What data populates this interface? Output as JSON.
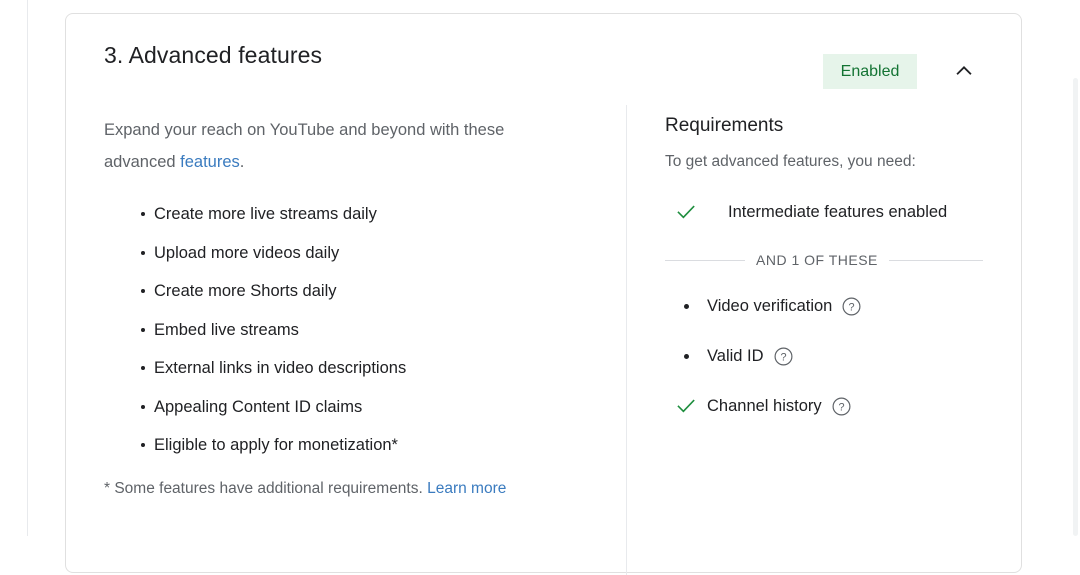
{
  "card": {
    "title": "3. Advanced features",
    "status_badge": "Enabled",
    "collapse_icon": "chevron-up-icon",
    "badge_bg_color": "#e6f4ea",
    "badge_text_color": "#137333"
  },
  "left": {
    "lede_before": "Expand your reach on YouTube and beyond with these advanced ",
    "lede_link": "features",
    "lede_after": ".",
    "features": [
      "Create more live streams daily",
      "Upload more videos daily",
      "Create more Shorts daily",
      "Embed live streams",
      "External links in video descriptions",
      "Appealing Content ID claims",
      "Eligible to apply for monetization*"
    ],
    "footnote_text": "* Some features have additional requirements. ",
    "footnote_link": "Learn more",
    "link_color": "#3a7bbf"
  },
  "right": {
    "title": "Requirements",
    "subtitle": "To get advanced features, you need:",
    "primary_requirement": {
      "label": "Intermediate features enabled",
      "marker": "check-icon",
      "status": "met"
    },
    "divider_label": "AND 1 OF THESE",
    "options": [
      {
        "label": "Video verification",
        "marker": "bullet",
        "status": "unmet",
        "help": "help-circle-icon"
      },
      {
        "label": "Valid ID",
        "marker": "bullet",
        "status": "unmet",
        "help": "help-circle-icon"
      },
      {
        "label": "Channel history",
        "marker": "check-icon",
        "status": "met",
        "help": "help-circle-icon"
      }
    ],
    "check_color": "#1e8e3e"
  }
}
